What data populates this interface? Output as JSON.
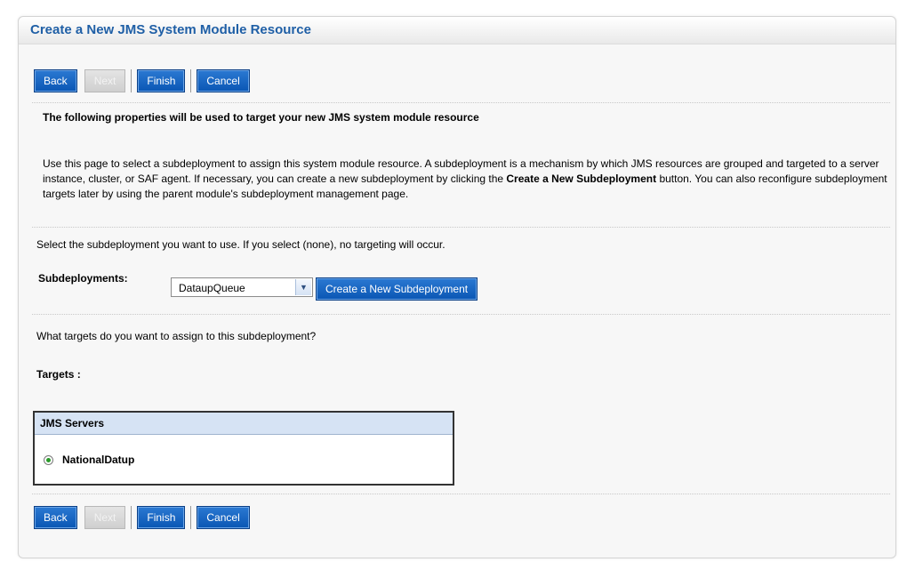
{
  "page_title": "Create a New JMS System Module Resource",
  "buttons": {
    "back": "Back",
    "next": "Next",
    "finish": "Finish",
    "cancel": "Cancel"
  },
  "intro_heading": "The following properties will be used to target your new JMS system module resource",
  "description": {
    "part1": "Use this page to select a subdeployment to assign this system module resource. A subdeployment is a mechanism by which JMS resources are grouped and targeted to a server instance, cluster, or SAF agent. If necessary, you can create a new subdeployment by clicking the ",
    "highlight": "Create a New Subdeployment",
    "part2": " button. You can also reconfigure subdeployment targets later by using the parent module's subdeployment management page."
  },
  "subdeployment_instruction": "Select the subdeployment you want to use. If you select (none), no targeting will occur.",
  "subdeployments": {
    "label": "Subdeployments:",
    "selected": "DataupQueue",
    "create_button": "Create a New Subdeployment"
  },
  "targets_question": "What targets do you want to assign to this subdeployment?",
  "targets_label": "Targets :",
  "jms_servers": {
    "header": "JMS Servers",
    "options": [
      {
        "label": "NationalDatup",
        "selected": true
      }
    ]
  }
}
